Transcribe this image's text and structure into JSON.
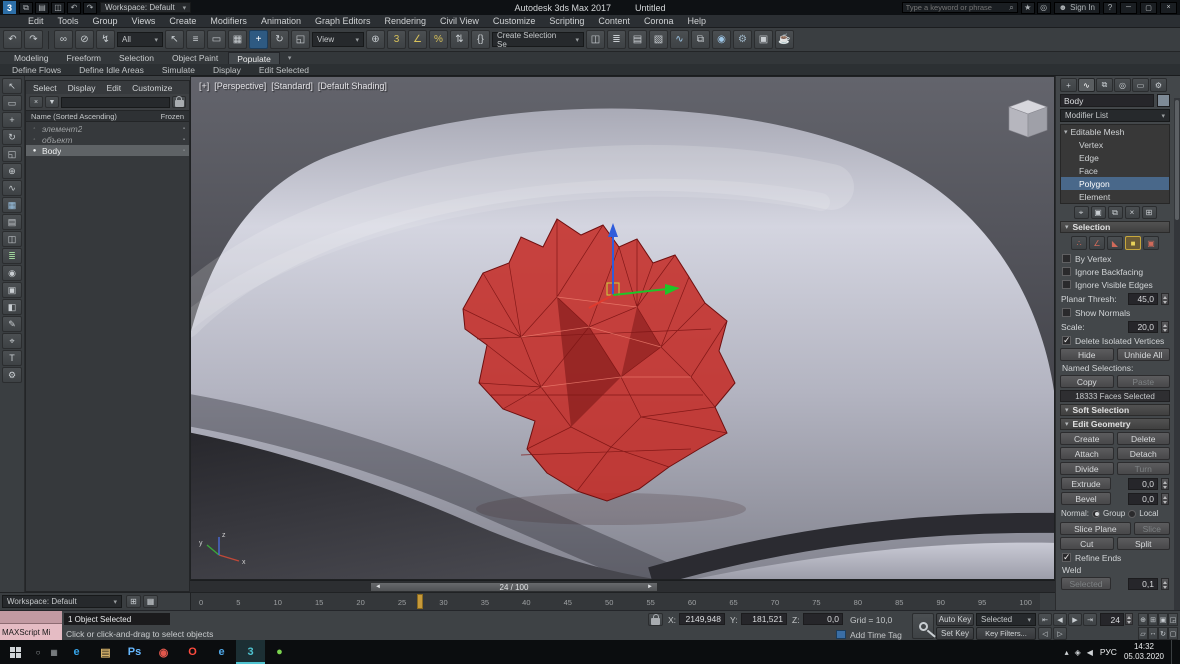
{
  "titlebar": {
    "logo_glyph": "3",
    "quick_icons": [
      {
        "n": "new-scene-icon",
        "g": "⧉"
      },
      {
        "n": "open-file-icon",
        "g": "▤"
      },
      {
        "n": "save-file-icon",
        "g": "◫"
      },
      {
        "n": "undo-quick-icon",
        "g": "↶"
      },
      {
        "n": "redo-quick-icon",
        "g": "↷"
      }
    ],
    "workspace_label": "Workspace: Default",
    "app_title": "Autodesk 3ds Max 2017",
    "doc_title": "Untitled",
    "search_placeholder": "Type a keyword or phrase",
    "search_icon": "⌕",
    "right_icons": [
      {
        "n": "favorites-star-icon",
        "g": "★"
      },
      {
        "n": "notifications-icon",
        "g": "◎"
      }
    ],
    "user_icon": "☻",
    "signin_label": "Sign In",
    "help_icon": "?",
    "win_min": "─",
    "win_max": "▢",
    "win_close": "×"
  },
  "menubar": {
    "items": [
      "Edit",
      "Tools",
      "Group",
      "Views",
      "Create",
      "Modifiers",
      "Animation",
      "Graph Editors",
      "Rendering",
      "Civil View",
      "Customize",
      "Scripting",
      "Content",
      "Corona",
      "Help"
    ]
  },
  "toolbar": {
    "group_a": [
      {
        "n": "undo-icon",
        "g": "↶"
      },
      {
        "n": "redo-icon",
        "g": "↷"
      }
    ],
    "group_b": [
      {
        "n": "select-link-icon",
        "g": "∞"
      },
      {
        "n": "unlink-icon",
        "g": "⊘"
      },
      {
        "n": "bind-spacewarp-icon",
        "g": "↯"
      }
    ],
    "filter_value": "All",
    "group_c": [
      {
        "n": "select-object-icon",
        "g": "↖"
      },
      {
        "n": "select-by-name-icon",
        "g": "≡"
      },
      {
        "n": "rect-region-icon",
        "g": "▭"
      },
      {
        "n": "crossing-selection-icon",
        "g": "▦"
      },
      {
        "n": "select-move-icon",
        "g": "+",
        "cls": "active"
      },
      {
        "n": "select-rotate-icon",
        "g": "↻"
      },
      {
        "n": "select-scale-icon",
        "g": "◱"
      }
    ],
    "view_value": "View",
    "group_d": [
      {
        "n": "use-pivot-icon",
        "g": "⊕"
      },
      {
        "n": "snap-toggle-icon",
        "g": "3",
        "c": "#d8c25a"
      },
      {
        "n": "angle-snap-icon",
        "g": "∠",
        "c": "#d8c25a"
      },
      {
        "n": "percent-snap-icon",
        "g": "%",
        "c": "#d8c25a"
      },
      {
        "n": "spinner-snap-icon",
        "g": "⇅"
      },
      {
        "n": "named-selection-sets-icon",
        "g": "{}"
      }
    ],
    "selection_set_value": "Create Selection Se",
    "group_e": [
      {
        "n": "mirror-icon",
        "g": "◫"
      },
      {
        "n": "align-icon",
        "g": "≣"
      },
      {
        "n": "layer-manager-icon",
        "g": "▤"
      },
      {
        "n": "ribbon-toggle-icon",
        "g": "▧"
      },
      {
        "n": "curve-editor-icon",
        "g": "∿",
        "c": "#9ec7e8"
      },
      {
        "n": "schematic-view-icon",
        "g": "⧉"
      },
      {
        "n": "material-editor-icon",
        "g": "◉",
        "c": "#9ec7e8"
      },
      {
        "n": "render-setup-icon",
        "g": "⚙",
        "c": "#9fb6c8"
      },
      {
        "n": "rendered-frame-icon",
        "g": "▣"
      },
      {
        "n": "render-icon",
        "g": "☕",
        "c": "#5fb4c8"
      }
    ]
  },
  "ribbon": {
    "tabs": [
      {
        "n": "ribbon-tab-modeling",
        "label": "Modeling"
      },
      {
        "n": "ribbon-tab-freeform",
        "label": "Freeform"
      },
      {
        "n": "ribbon-tab-selection",
        "label": "Selection"
      },
      {
        "n": "ribbon-tab-object-paint",
        "label": "Object Paint"
      },
      {
        "n": "ribbon-tab-populate",
        "label": "Populate",
        "cls": "active"
      }
    ],
    "minimize_icon": "▾",
    "tools": [
      "Define Flows",
      "Define Idle Areas",
      "Simulate",
      "Display",
      "Edit Selected"
    ]
  },
  "left_toolbar": {
    "icons": [
      {
        "n": "left-select-icon",
        "g": "↖"
      },
      {
        "n": "left-rect-icon",
        "g": "▭"
      },
      {
        "n": "left-move-icon",
        "g": "+"
      },
      {
        "n": "left-rotate-icon",
        "g": "↻"
      },
      {
        "n": "left-scale-icon",
        "g": "◱"
      },
      {
        "n": "left-snap-icon",
        "g": "⊕"
      },
      {
        "n": "left-curves-icon",
        "g": "∿"
      },
      {
        "n": "left-grid-icon",
        "g": "▦",
        "c": "#9ec7e8"
      },
      {
        "n": "left-layers-icon",
        "g": "▤"
      },
      {
        "n": "left-mirror-icon",
        "g": "◫"
      },
      {
        "n": "left-align-icon",
        "g": "≣",
        "c": "#9ed49a"
      },
      {
        "n": "left-material-icon",
        "g": "◉"
      },
      {
        "n": "left-render-icon",
        "g": "▣"
      },
      {
        "n": "left-display-icon",
        "g": "◧"
      },
      {
        "n": "left-edit-icon",
        "g": "✎"
      },
      {
        "n": "left-measure-icon",
        "g": "⌖"
      },
      {
        "n": "left-text-icon",
        "g": "T"
      },
      {
        "n": "left-gear-icon",
        "g": "⚙"
      }
    ]
  },
  "scene_explorer": {
    "menus": [
      "Select",
      "Display",
      "Edit",
      "Customize"
    ],
    "clear_icon": "×",
    "filter_icon": "▼",
    "header_name": "Name (Sorted Ascending)",
    "header_frozen": "Frozen",
    "rows": [
      {
        "label": "элемент2",
        "icon": "◦",
        "frozen_icon": "▪"
      },
      {
        "label": "объект",
        "icon": "◦",
        "frozen_icon": "▪"
      },
      {
        "label": "Body",
        "icon": "●",
        "frozen_icon": "▪"
      }
    ]
  },
  "viewport": {
    "label_segments": [
      "[+]",
      "[Perspective]",
      "[Standard]",
      "[Default Shading]"
    ],
    "axis_x": "x",
    "axis_y": "y",
    "axis_z": "z"
  },
  "timeline": {
    "slider_prev": "◄",
    "slider_next": "►",
    "slider_value": "24 / 100",
    "ticks": [
      "0",
      "5",
      "10",
      "15",
      "20",
      "25",
      "30",
      "35",
      "40",
      "45",
      "50",
      "55",
      "60",
      "65",
      "70",
      "75",
      "80",
      "85",
      "90",
      "95",
      "100"
    ]
  },
  "bottombar": {
    "workspace_label": "Workspace: Default",
    "icons": [
      {
        "n": "isolate-toggle-icon",
        "g": "⊞"
      },
      {
        "n": "offset-mode-icon",
        "g": "▦"
      }
    ]
  },
  "command_panel": {
    "tabs": [
      {
        "n": "create-tab-icon",
        "g": "+"
      },
      {
        "n": "modify-tab-icon",
        "g": "∿",
        "cls": "active"
      },
      {
        "n": "hierarchy-tab-icon",
        "g": "⧉"
      },
      {
        "n": "motion-tab-icon",
        "g": "◎"
      },
      {
        "n": "display-tab-icon",
        "g": "▭"
      },
      {
        "n": "utilities-tab-icon",
        "g": "⚙"
      }
    ],
    "object_name": "Body",
    "modifier_list_label": "Modifier List",
    "stack_root": "Editable Mesh",
    "stack_children": [
      {
        "n": "stack-vertex-row",
        "label": "Vertex"
      },
      {
        "n": "stack-edge-row",
        "label": "Edge"
      },
      {
        "n": "stack-face-row",
        "label": "Face"
      },
      {
        "n": "stack-polygon-row",
        "label": "Polygon",
        "cls": "active"
      },
      {
        "n": "stack-element-row",
        "label": "Element"
      }
    ],
    "stack_ops": [
      {
        "n": "pin-stack-icon",
        "g": "⌖"
      },
      {
        "n": "show-end-result-icon",
        "g": "▣"
      },
      {
        "n": "make-unique-icon",
        "g": "⧉"
      },
      {
        "n": "remove-modifier-icon",
        "g": "×"
      },
      {
        "n": "configure-modifier-icon",
        "g": "⊞"
      }
    ],
    "subobject_icons": [
      {
        "n": "vertex-subobject-icon",
        "g": "∴"
      },
      {
        "n": "edge-subobject-icon",
        "g": "∠"
      },
      {
        "n": "face-subobject-icon",
        "g": "◣"
      },
      {
        "n": "polygon-subobject-icon",
        "g": "■",
        "cls": "active"
      },
      {
        "n": "element-subobject-icon",
        "g": "▣"
      }
    ],
    "selection": {
      "title": "Selection",
      "by_vertex": "By Vertex",
      "ignore_backfacing": "Ignore Backfacing",
      "ignore_visible": "Ignore Visible Edges",
      "planar_label": "Planar Thresh:",
      "planar_value": "45,0",
      "show_normals": "Show Normals",
      "scale_label": "Scale:",
      "scale_value": "20,0",
      "delete_isolated": "Delete Isolated Vertices",
      "hide": "Hide",
      "unhide": "Unhide All",
      "named_label": "Named Selections:",
      "copy": "Copy",
      "paste": "Paste",
      "faces_selected": "18333 Faces Selected"
    },
    "soft_selection_title": "Soft Selection",
    "edit_geometry": {
      "title": "Edit Geometry",
      "create": "Create",
      "delete": "Delete",
      "attach": "Attach",
      "detach": "Detach",
      "divide": "Divide",
      "turn": "Turn",
      "extrude": "Extrude",
      "extrude_value": "0,0",
      "bevel": "Bevel",
      "bevel_value": "0,0",
      "normal_label": "Normal:",
      "group": "Group",
      "local": "Local",
      "slice_plane": "Slice Plane",
      "slice": "Slice",
      "cut": "Cut",
      "split": "Split",
      "refine_ends": "Refine Ends",
      "weld_label": "Weld",
      "selected": "Selected",
      "selected_value": "0,1"
    }
  },
  "status": {
    "maxscript_label": "MAXScript Mi",
    "selection_label": "1 Object Selected",
    "prompt": "Click or click-and-drag to select objects",
    "x_label": "X:",
    "x_value": "2149,948",
    "y_label": "Y:",
    "y_value": "181,521",
    "z_label": "Z:",
    "z_value": "0,0",
    "grid_label": "Grid = 10,0",
    "time_tag_label": "Add Time Tag",
    "auto_key": "Auto Key",
    "selected_dd": "Selected",
    "set_key": "Set Key",
    "key_filters": "Key Filters...",
    "frame_value": "24",
    "playback": [
      {
        "n": "go-start-button",
        "g": "⇤"
      },
      {
        "n": "prev-frame-button",
        "g": "◀"
      },
      {
        "n": "play-button",
        "g": "▶"
      },
      {
        "n": "go-end-button",
        "g": "⇥"
      }
    ],
    "playback2": [
      {
        "n": "prev-key-button",
        "g": "◁"
      },
      {
        "n": "next-key-button",
        "g": "▷"
      }
    ],
    "nav1": [
      {
        "n": "zoom-icon",
        "g": "⊕"
      },
      {
        "n": "zoom-all-icon",
        "g": "⊞"
      },
      {
        "n": "zoom-extents-icon",
        "g": "▣"
      },
      {
        "n": "zoom-region-icon",
        "g": "◲"
      }
    ],
    "nav2": [
      {
        "n": "fov-icon",
        "g": "▱"
      },
      {
        "n": "pan-icon",
        "g": "↔"
      },
      {
        "n": "orbit-icon",
        "g": "↻"
      },
      {
        "n": "maximize-viewport-icon",
        "g": "▢"
      }
    ]
  },
  "taskbar": {
    "sys_icons": [
      {
        "n": "taskbar-search-icon",
        "g": "○"
      },
      {
        "n": "task-view-icon",
        "g": "▦"
      }
    ],
    "apps": [
      {
        "n": "taskbar-ie-icon",
        "g": "e",
        "c": "#35a3e8"
      },
      {
        "n": "taskbar-folder-icon",
        "g": "▤",
        "c": "#d8b36a"
      },
      {
        "n": "taskbar-photoshop-icon",
        "g": "Ps",
        "c": "#66b8ff"
      },
      {
        "n": "taskbar-chrome-icon",
        "g": "◉",
        "c": "#e2574c"
      },
      {
        "n": "taskbar-opera-icon",
        "g": "O",
        "c": "#ff4b3e"
      },
      {
        "n": "taskbar-edge-icon",
        "g": "e",
        "c": "#4fa8e8"
      },
      {
        "n": "taskbar-3dsmax-icon",
        "g": "3",
        "c": "#4fc3d0",
        "cls": "active"
      },
      {
        "n": "taskbar-corona-icon",
        "g": "●",
        "c": "#7bd34f"
      }
    ],
    "tray_icons": [
      {
        "n": "tray-up-arrow-icon",
        "g": "▴"
      },
      {
        "n": "tray-shield-icon",
        "g": "◈"
      },
      {
        "n": "tray-volume-icon",
        "g": "◀"
      }
    ],
    "lang_label": "РУС",
    "time_label": "14:32",
    "date_label": "05.03.2020"
  }
}
